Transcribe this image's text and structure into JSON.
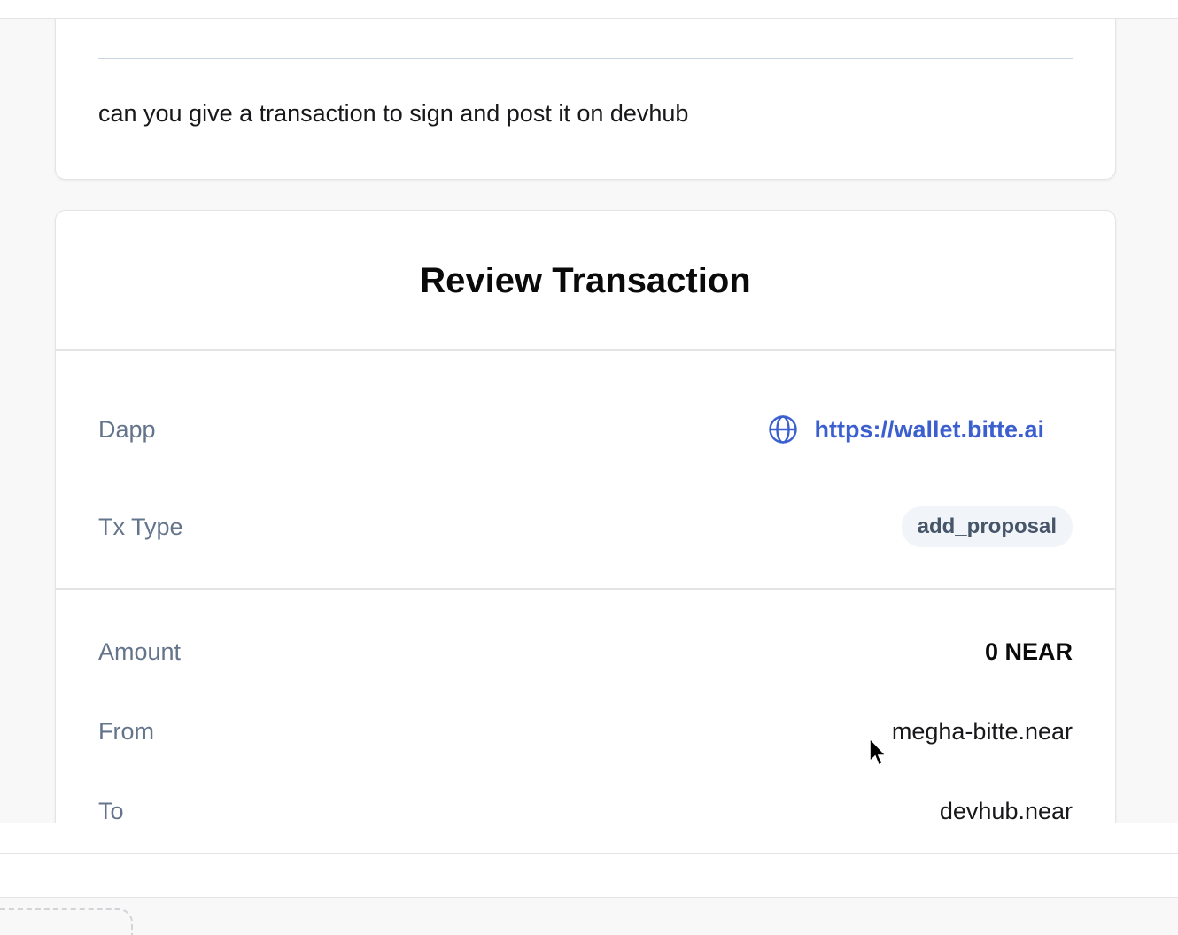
{
  "message": {
    "text": "can you give a transaction to sign and post it on devhub"
  },
  "review": {
    "title": "Review Transaction",
    "dapp": {
      "label": "Dapp",
      "value": "https://wallet.bitte.ai",
      "icon": "globe-icon"
    },
    "tx_type": {
      "label": "Tx Type",
      "value": "add_proposal"
    },
    "amount": {
      "label": "Amount",
      "value": "0 NEAR"
    },
    "from": {
      "label": "From",
      "value": "megha-bitte.near"
    },
    "to": {
      "label": "To",
      "value": "devhub.near"
    }
  },
  "colors": {
    "link": "#3b5fcf",
    "label": "#64748b",
    "pill_bg": "#f1f5f9"
  }
}
